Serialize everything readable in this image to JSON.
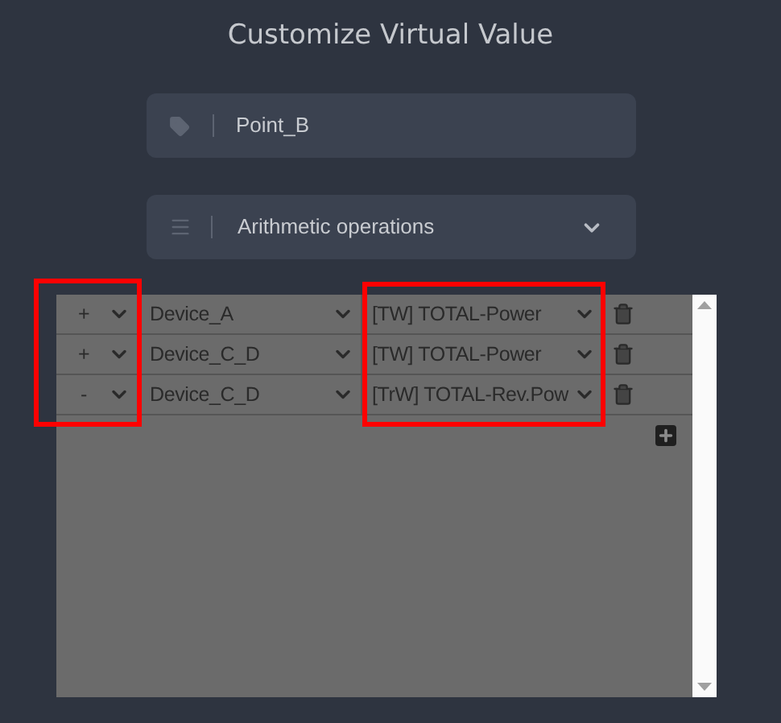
{
  "title": "Customize Virtual Value",
  "name_field": {
    "value": "Point_B"
  },
  "mode_select": {
    "value": "Arithmetic operations"
  },
  "rows": [
    {
      "operator": "+",
      "device": "Device_A",
      "parameter": "[TW] TOTAL-Power"
    },
    {
      "operator": "+",
      "device": "Device_C_D",
      "parameter": "[TW] TOTAL-Power"
    },
    {
      "operator": "-",
      "device": "Device_C_D",
      "parameter": "[TrW] TOTAL-Rev.Pow"
    }
  ],
  "highlight_frames": {
    "operator_column": true,
    "parameter_column": true
  }
}
